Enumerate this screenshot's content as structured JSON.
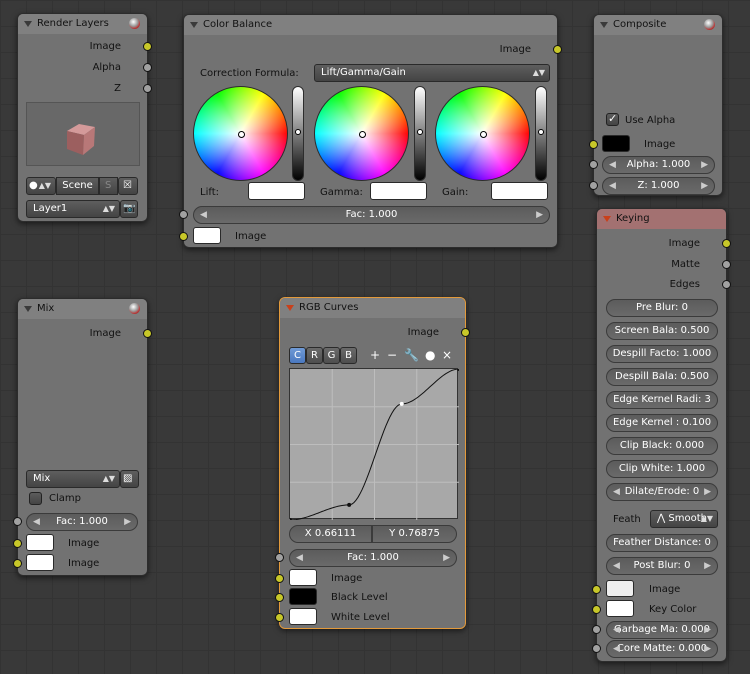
{
  "colors": {
    "editor_bg": "#393939",
    "node_bg": "#727272",
    "socket_image": "#c7c729",
    "socket_value": "#a1a1a1",
    "selected_outline": "#e39a3b"
  },
  "render_layers": {
    "title": "Render Layers",
    "outputs": [
      "Image",
      "Alpha",
      "Z"
    ],
    "scene_label": "Scene",
    "scene_extra": "S",
    "layer_value": "Layer1"
  },
  "color_balance": {
    "title": "Color Balance",
    "output": "Image",
    "formula_label": "Correction Formula:",
    "formula_value": "Lift/Gamma/Gain",
    "wheel_labels": [
      "Lift:",
      "Gamma:",
      "Gain:"
    ],
    "fac": "Fac: 1.000",
    "input": "Image"
  },
  "composite": {
    "title": "Composite",
    "use_alpha_label": "Use Alpha",
    "use_alpha": true,
    "image_label": "Image",
    "alpha_field": "Alpha: 1.000",
    "z_field": "Z: 1.000"
  },
  "keying": {
    "title": "Keying",
    "outputs": [
      "Image",
      "Matte",
      "Edges"
    ],
    "fields": [
      "Pre Blur: 0",
      "Screen Bala: 0.500",
      "Despill Facto: 1.000",
      "Despill Bala: 0.500",
      "Edge Kernel Radi: 3",
      "Edge Kernel : 0.100",
      "Clip Black: 0.000",
      "Clip White: 1.000",
      "Dilate/Erode: 0"
    ],
    "feather_label": "Feath",
    "feather_value": "Smooth",
    "feather_fields": [
      "Feather Distance: 0",
      "Post Blur: 0"
    ],
    "inputs": [
      "Image",
      "Key Color"
    ],
    "bottom_fields": [
      "Garbage Ma: 0.000",
      "Core Matte: 0.000"
    ]
  },
  "mix": {
    "title": "Mix",
    "output": "Image",
    "blend_value": "Mix",
    "clamp_label": "Clamp",
    "clamp": false,
    "fac": "Fac: 1.000",
    "inputs": [
      "Image",
      "Image"
    ]
  },
  "rgb_curves": {
    "title": "RGB Curves",
    "output": "Image",
    "channels": [
      "C",
      "R",
      "G",
      "B"
    ],
    "active_channel": "C",
    "tools": {
      "add": "+",
      "remove": "−",
      "wrench": "wrench-icon",
      "reset": "×"
    },
    "x_readout": "X 0.66111",
    "y_readout": "Y 0.76875",
    "fac": "Fac: 1.000",
    "inputs": [
      "Image",
      "Black Level",
      "White Level"
    ],
    "curve_points": [
      [
        0,
        0
      ],
      [
        0.35,
        0.1
      ],
      [
        0.66111,
        0.76875
      ],
      [
        1,
        1
      ]
    ]
  }
}
